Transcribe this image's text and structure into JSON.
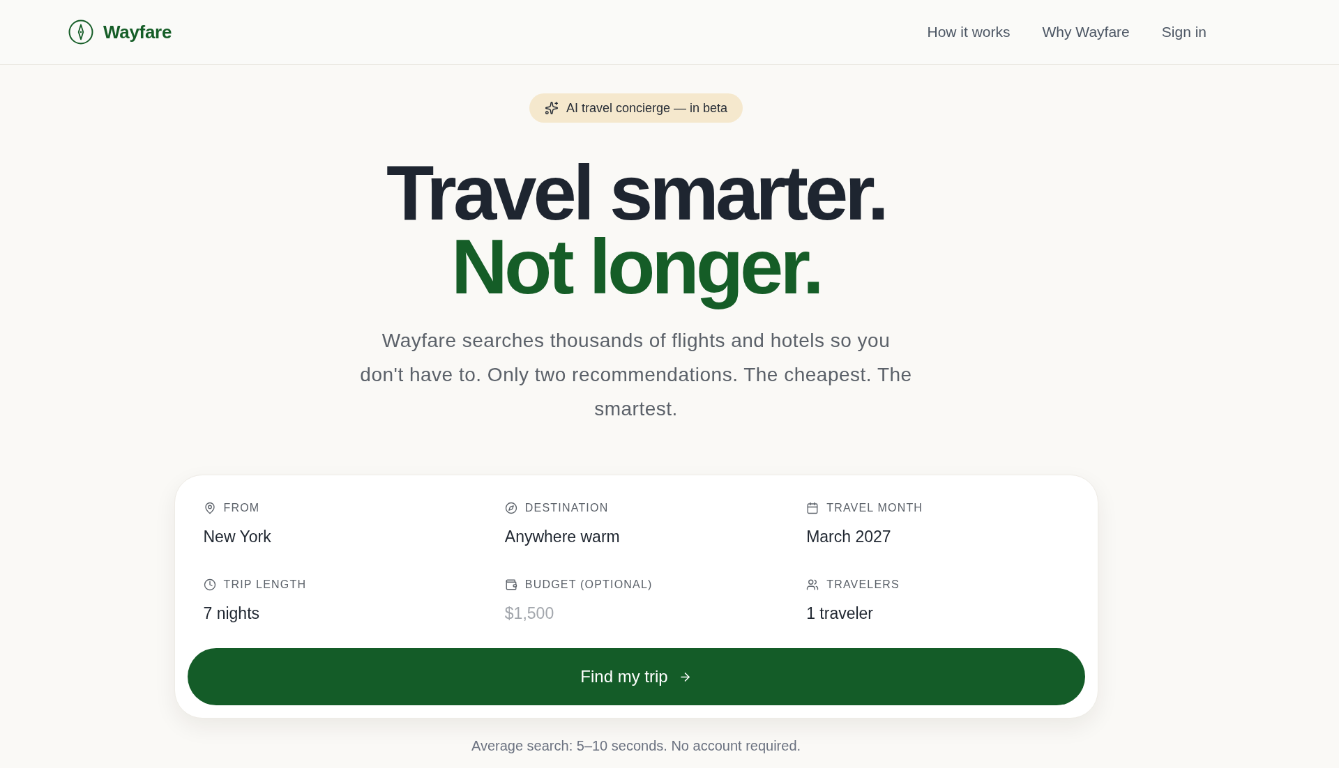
{
  "header": {
    "brand": "Wayfare",
    "nav": [
      {
        "label": "How it works"
      },
      {
        "label": "Why Wayfare"
      },
      {
        "label": "Sign in"
      }
    ]
  },
  "hero": {
    "badge": "AI travel concierge — in beta",
    "headline": "Travel smarter.",
    "headline_accent": "Not longer.",
    "subtitle": "Wayfare searches thousands of flights and hotels so you don't have to. Only two recommendations. The cheapest. The smartest."
  },
  "search_form": {
    "fields": [
      {
        "kind": "origin",
        "label": "FROM",
        "value": "New York"
      },
      {
        "kind": "destination",
        "label": "DESTINATION",
        "value": "Anywhere warm"
      },
      {
        "kind": "month",
        "label": "TRAVEL MONTH",
        "value": "March 2027"
      },
      {
        "kind": "duration",
        "label": "TRIP LENGTH",
        "value": "7 nights"
      },
      {
        "kind": "budget",
        "label": "BUDGET (OPTIONAL)",
        "placeholder": "$1,500"
      },
      {
        "kind": "travelers",
        "label": "TRAVELERS",
        "value": "1 traveler"
      }
    ],
    "submit": "Find my trip"
  },
  "footnote": "Average search: 5–10 seconds. No account required."
}
